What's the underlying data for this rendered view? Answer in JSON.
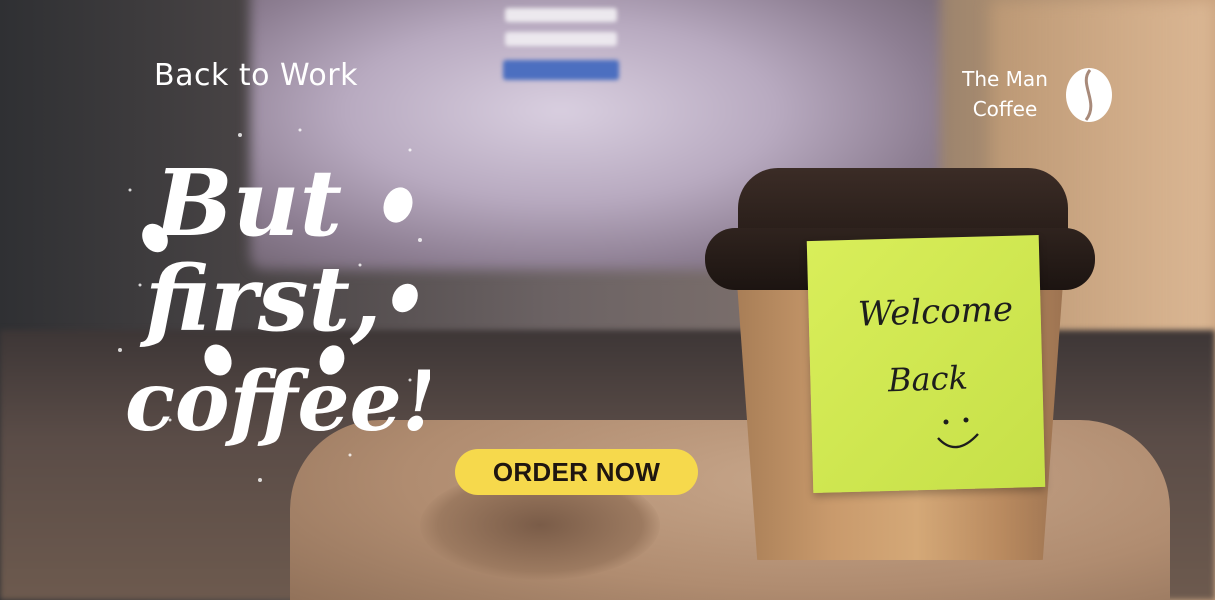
{
  "headline": {
    "top_text": "Back to Work"
  },
  "brand": {
    "line1": "The Man",
    "line2": "Coffee",
    "icon": "coffee-bean-icon"
  },
  "lettering": {
    "line1": "But",
    "line2": "first,",
    "line3": "coffee!"
  },
  "sticky_note": {
    "line1": "Welcome",
    "line2": "Back"
  },
  "cta": {
    "label": "ORDER NOW"
  },
  "colors": {
    "cta_bg": "#f6d94c",
    "note": "#d2e852",
    "text": "#ffffff"
  }
}
